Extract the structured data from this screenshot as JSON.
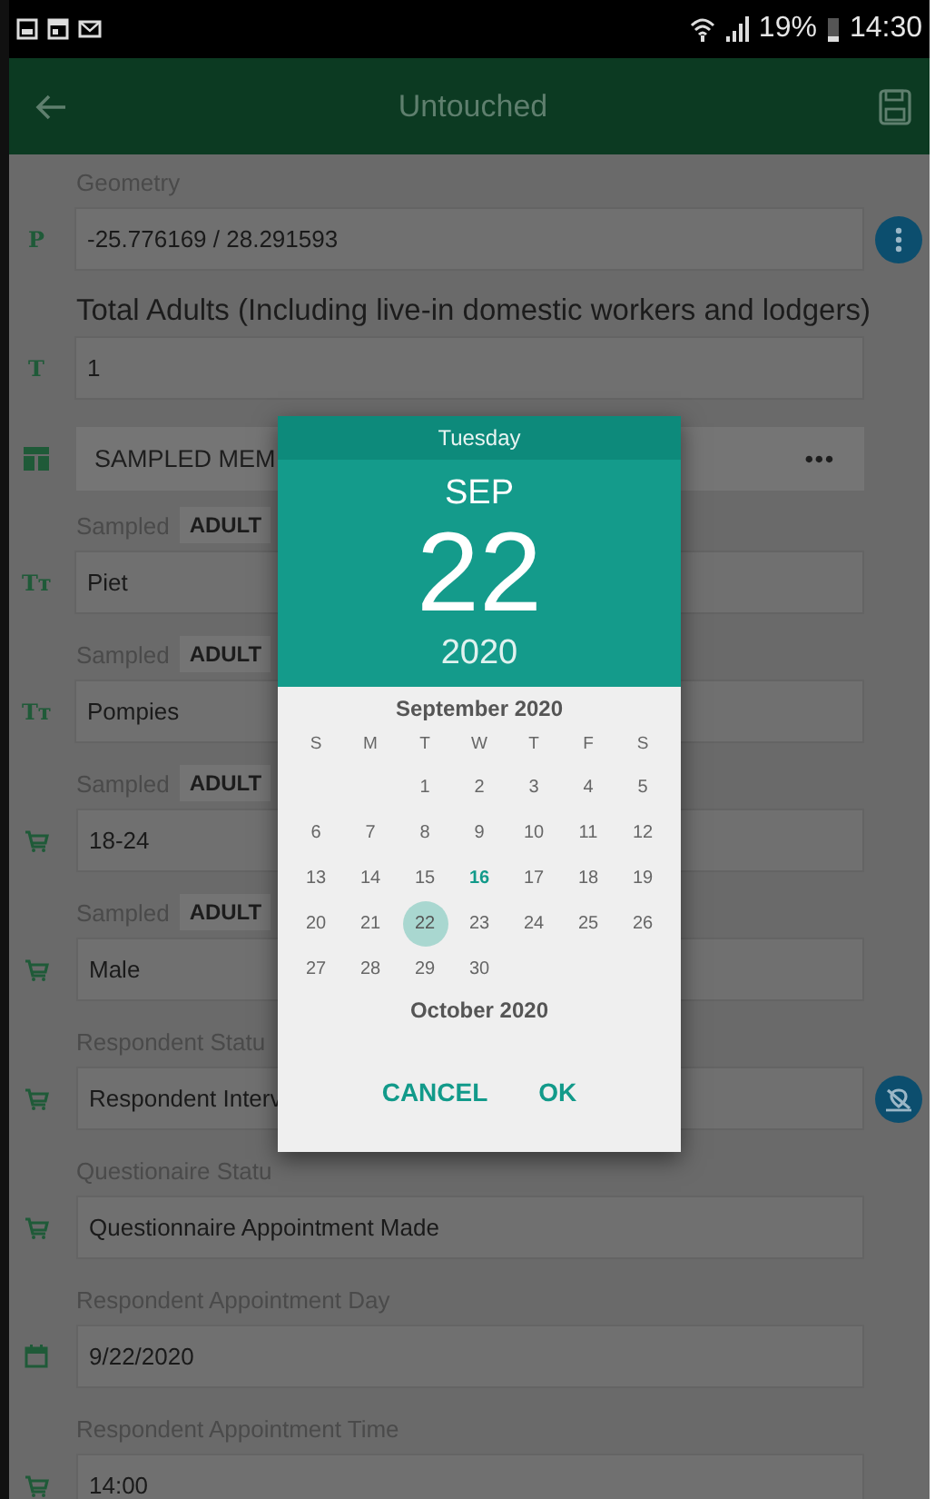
{
  "status_bar": {
    "battery_text": "19%",
    "time": "14:30"
  },
  "app_bar": {
    "title": "Untouched"
  },
  "form": [
    {
      "kind": "location_field",
      "label": "Geometry",
      "label_large": false,
      "glyph": "P",
      "value": "-25.776169 / 28.291593"
    },
    {
      "kind": "text_field",
      "label": "Total Adults (Including live-in domestic workers and lodgers)",
      "label_large": true,
      "glyph": "T",
      "value": "1"
    },
    {
      "kind": "group",
      "title": "SAMPLED MEM",
      "more": "•••"
    },
    {
      "kind": "text_field",
      "label": "Sampled",
      "chip": "ADULT",
      "label_large": false,
      "glyph": "Tт",
      "value": "Piet"
    },
    {
      "kind": "text_field",
      "label": "Sampled",
      "chip": "ADULT",
      "label_large": false,
      "glyph": "Tт",
      "value": "Pompies"
    },
    {
      "kind": "choice_field",
      "label": "Sampled",
      "chip": "ADULT",
      "label_large": false,
      "value": "18-24"
    },
    {
      "kind": "choice_field",
      "label": "Sampled",
      "chip": "ADULT",
      "label_large": false,
      "value": "Male"
    },
    {
      "kind": "status_field",
      "label": "Respondent Statu",
      "label_large": false,
      "value": "Respondent Interv"
    },
    {
      "kind": "choice_field",
      "label": "Questionaire Statu",
      "label_large": false,
      "value": "Questionnaire Appointment Made"
    },
    {
      "kind": "date_field",
      "label": "Respondent Appointment Day",
      "label_large": false,
      "value": "9/22/2020"
    },
    {
      "kind": "choice_field",
      "label": "Respondent Appointment Time",
      "label_large": false,
      "value": "14:00"
    }
  ],
  "date_dialog": {
    "weekday": "Tuesday",
    "month": "SEP",
    "day": "22",
    "year": "2020",
    "month_title": "September 2020",
    "weekday_headers": [
      "S",
      "M",
      "T",
      "W",
      "T",
      "F",
      "S"
    ],
    "weeks": [
      {
        "kind": "partial_start",
        "days": [
          {
            "label": "1",
            "selected": false,
            "today": false
          },
          {
            "label": "2",
            "selected": false,
            "today": false
          },
          {
            "label": "3",
            "selected": false,
            "today": false
          },
          {
            "label": "4",
            "selected": false,
            "today": false
          },
          {
            "label": "5",
            "selected": false,
            "today": false
          }
        ]
      },
      {
        "kind": "full",
        "days": [
          {
            "label": "6",
            "selected": false,
            "today": false
          },
          {
            "label": "7",
            "selected": false,
            "today": false
          },
          {
            "label": "8",
            "selected": false,
            "today": false
          },
          {
            "label": "9",
            "selected": false,
            "today": false
          },
          {
            "label": "10",
            "selected": false,
            "today": false
          },
          {
            "label": "11",
            "selected": false,
            "today": false
          },
          {
            "label": "12",
            "selected": false,
            "today": false
          }
        ]
      },
      {
        "kind": "full",
        "days": [
          {
            "label": "13",
            "selected": false,
            "today": false
          },
          {
            "label": "14",
            "selected": false,
            "today": false
          },
          {
            "label": "15",
            "selected": false,
            "today": false
          },
          {
            "label": "16",
            "selected": false,
            "today": true
          },
          {
            "label": "17",
            "selected": false,
            "today": false
          },
          {
            "label": "18",
            "selected": false,
            "today": false
          },
          {
            "label": "19",
            "selected": false,
            "today": false
          }
        ]
      },
      {
        "kind": "full",
        "days": [
          {
            "label": "20",
            "selected": false,
            "today": false
          },
          {
            "label": "21",
            "selected": false,
            "today": false
          },
          {
            "label": "22",
            "selected": true,
            "today": false
          },
          {
            "label": "23",
            "selected": false,
            "today": false
          },
          {
            "label": "24",
            "selected": false,
            "today": false
          },
          {
            "label": "25",
            "selected": false,
            "today": false
          },
          {
            "label": "26",
            "selected": false,
            "today": false
          }
        ]
      },
      {
        "kind": "partial_end",
        "days": [
          {
            "label": "27",
            "selected": false,
            "today": false
          },
          {
            "label": "28",
            "selected": false,
            "today": false
          },
          {
            "label": "29",
            "selected": false,
            "today": false
          },
          {
            "label": "30",
            "selected": false,
            "today": false
          }
        ]
      }
    ],
    "next_month_title": "October 2020",
    "buttons": [
      "CANCEL",
      "OK"
    ]
  }
}
